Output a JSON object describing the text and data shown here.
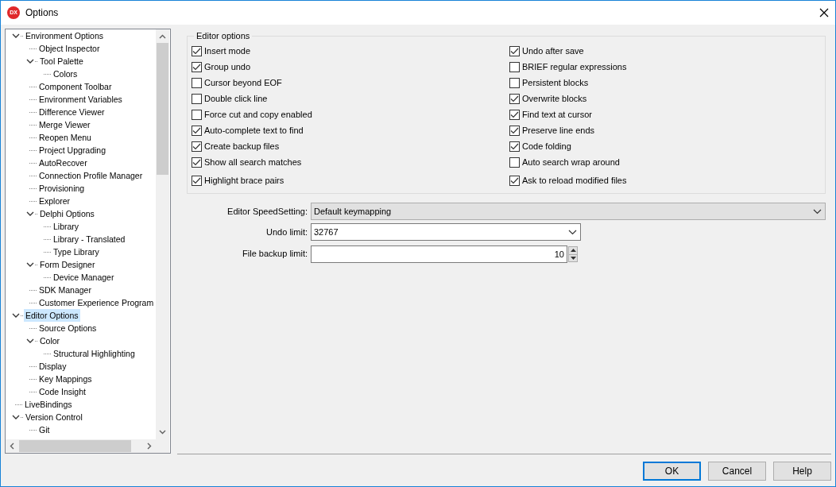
{
  "window": {
    "icon_text": "DX",
    "title": "Options"
  },
  "tree": [
    {
      "label": "Environment Options",
      "selected": false,
      "expanded": true,
      "children": [
        {
          "label": "Object Inspector",
          "selected": false
        },
        {
          "label": "Tool Palette",
          "selected": false,
          "expanded": true,
          "children": [
            {
              "label": "Colors",
              "selected": false
            }
          ]
        },
        {
          "label": "Component Toolbar",
          "selected": false
        },
        {
          "label": "Environment Variables",
          "selected": false
        },
        {
          "label": "Difference Viewer",
          "selected": false
        },
        {
          "label": "Merge Viewer",
          "selected": false
        },
        {
          "label": "Reopen Menu",
          "selected": false
        },
        {
          "label": "Project Upgrading",
          "selected": false
        },
        {
          "label": "AutoRecover",
          "selected": false
        },
        {
          "label": "Connection Profile Manager",
          "selected": false
        },
        {
          "label": "Provisioning",
          "selected": false
        },
        {
          "label": "Explorer",
          "selected": false
        },
        {
          "label": "Delphi Options",
          "selected": false,
          "expanded": true,
          "children": [
            {
              "label": "Library",
              "selected": false
            },
            {
              "label": "Library - Translated",
              "selected": false
            },
            {
              "label": "Type Library",
              "selected": false
            }
          ]
        },
        {
          "label": "Form Designer",
          "selected": false,
          "expanded": true,
          "children": [
            {
              "label": "Device Manager",
              "selected": false
            }
          ]
        },
        {
          "label": "SDK Manager",
          "selected": false
        },
        {
          "label": "Customer Experience Program",
          "selected": false
        }
      ]
    },
    {
      "label": "Editor Options",
      "selected": true,
      "expanded": true,
      "children": [
        {
          "label": "Source Options",
          "selected": false
        },
        {
          "label": "Color",
          "selected": false,
          "expanded": true,
          "children": [
            {
              "label": "Structural Highlighting",
              "selected": false
            }
          ]
        },
        {
          "label": "Display",
          "selected": false
        },
        {
          "label": "Key Mappings",
          "selected": false
        },
        {
          "label": "Code Insight",
          "selected": false
        }
      ]
    },
    {
      "label": "LiveBindings",
      "selected": false
    },
    {
      "label": "Version Control",
      "selected": false,
      "expanded": true,
      "children": [
        {
          "label": "Git",
          "selected": false
        }
      ]
    }
  ],
  "editor_options": {
    "title": "Editor options",
    "left_column": [
      {
        "label": "Insert mode",
        "checked": true
      },
      {
        "label": "Group undo",
        "checked": true
      },
      {
        "label": "Cursor beyond EOF",
        "checked": false
      },
      {
        "label": "Double click line",
        "checked": false
      },
      {
        "label": "Force cut and copy enabled",
        "checked": false
      },
      {
        "label": "Auto-complete text to find",
        "checked": true
      },
      {
        "label": "Create backup files",
        "checked": true
      },
      {
        "label": "Show all search matches",
        "checked": true
      },
      {
        "label": "Highlight brace pairs",
        "checked": true
      }
    ],
    "right_column": [
      {
        "label": "Undo after save",
        "checked": true
      },
      {
        "label": "BRIEF regular expressions",
        "checked": false
      },
      {
        "label": "Persistent blocks",
        "checked": false
      },
      {
        "label": "Overwrite blocks",
        "checked": true
      },
      {
        "label": "Find text at cursor",
        "checked": true
      },
      {
        "label": "Preserve line ends",
        "checked": true
      },
      {
        "label": "Code folding",
        "checked": true
      },
      {
        "label": "Auto search wrap around",
        "checked": false
      },
      {
        "label": "Ask to reload modified files",
        "checked": true
      }
    ]
  },
  "fields": [
    {
      "kind": "dropdown",
      "label": "Editor SpeedSetting:",
      "value": "Default keymapping"
    },
    {
      "kind": "combo",
      "label": "Undo limit:",
      "value": "32767"
    },
    {
      "kind": "spinner",
      "label": "File backup limit:",
      "value": "10"
    }
  ],
  "buttons": [
    {
      "label": "OK",
      "default": true
    },
    {
      "label": "Cancel",
      "default": false
    },
    {
      "label": "Help",
      "default": false
    }
  ]
}
